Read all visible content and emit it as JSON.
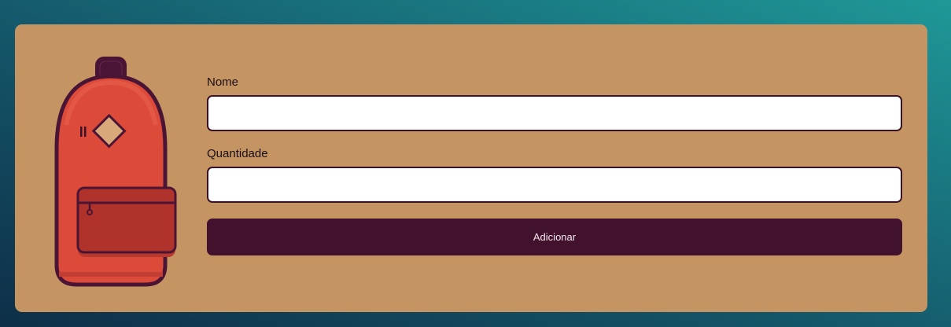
{
  "form": {
    "name_label": "Nome",
    "name_value": "",
    "quantity_label": "Quantidade",
    "quantity_value": "",
    "submit_label": "Adicionar"
  },
  "colors": {
    "background_gradient_dark": "#0e2f48",
    "background_gradient_light": "#1f9898",
    "card": "#c49563",
    "input_border": "#3b1127",
    "button": "#42112e",
    "backpack_body": "#dc4a3a",
    "backpack_pocket": "#b0332b",
    "backpack_outline": "#4a1535",
    "backpack_badge": "#d8a878"
  },
  "illustration": {
    "icon": "backpack-icon"
  }
}
